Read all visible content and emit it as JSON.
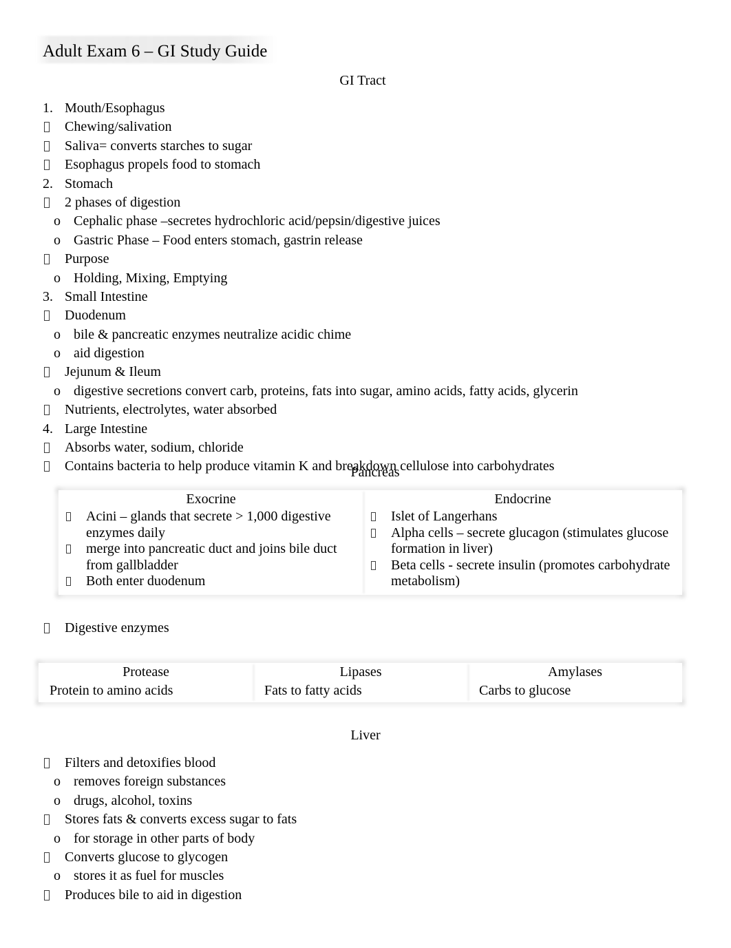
{
  "document": {
    "title": "Adult Exam 6 – GI Study Guide"
  },
  "sections": {
    "gi_tract": {
      "heading": "GI Tract",
      "items": [
        {
          "marker": "1.",
          "level": "num",
          "text": "Mouth/Esophagus"
        },
        {
          "marker": "tofu",
          "level": "sq",
          "text": "Chewing/salivation"
        },
        {
          "marker": "tofu",
          "level": "sq",
          "text": "Saliva= converts starches to sugar"
        },
        {
          "marker": "tofu",
          "level": "sq",
          "text": "Esophagus propels food to stomach"
        },
        {
          "marker": "2.",
          "level": "num",
          "text": "Stomach"
        },
        {
          "marker": "tofu",
          "level": "sq",
          "text": "2 phases of digestion"
        },
        {
          "marker": "o",
          "level": "o",
          "text": "Cephalic phase –secretes hydrochloric acid/pepsin/digestive juices"
        },
        {
          "marker": "o",
          "level": "o",
          "text": "Gastric Phase – Food enters stomach, gastrin release"
        },
        {
          "marker": "tofu",
          "level": "sq",
          "text": "Purpose"
        },
        {
          "marker": "o",
          "level": "o",
          "text": "Holding, Mixing, Emptying"
        },
        {
          "marker": "3.",
          "level": "num",
          "text": "Small Intestine"
        },
        {
          "marker": "tofu",
          "level": "sq",
          "text": "Duodenum"
        },
        {
          "marker": "o",
          "level": "o",
          "text": "bile & pancreatic enzymes neutralize acidic chime"
        },
        {
          "marker": "o",
          "level": "o",
          "text": "aid digestion"
        },
        {
          "marker": "tofu",
          "level": "sq",
          "text": "Jejunum & Ileum"
        },
        {
          "marker": "o",
          "level": "o",
          "text": "digestive secretions convert carb, proteins, fats into sugar, amino acids, fatty acids, glycerin"
        },
        {
          "marker": "tofu",
          "level": "sq",
          "text": " Nutrients, electrolytes, water absorbed"
        },
        {
          "marker": "4.",
          "level": "num",
          "text": "Large Intestine"
        },
        {
          "marker": "tofu",
          "level": "sq",
          "text": "Absorbs water, sodium, chloride"
        },
        {
          "marker": "tofu",
          "level": "sq",
          "text": "Contains bacteria to help produce vitamin K and breakdown cellulose into carbohydrates"
        }
      ]
    },
    "pancreas": {
      "heading": "Pancreas",
      "table": {
        "columns": [
          {
            "header": "Exocrine",
            "bullets": [
              "Acini – glands that secrete > 1,000 digestive enzymes daily",
              "merge into pancreatic duct and joins bile duct from gallbladder",
              "Both enter duodenum"
            ]
          },
          {
            "header": "Endocrine",
            "bullets": [
              "Islet of Langerhans",
              "Alpha cells – secrete glucagon (stimulates glucose formation in liver)",
              "Beta cells - secrete insulin (promotes carbohydrate metabolism)"
            ]
          }
        ]
      },
      "digestive_enzymes_item": {
        "marker": "tofu",
        "level": "sq",
        "text": "Digestive enzymes"
      },
      "enzyme_table": {
        "headers": [
          "Protease",
          "Lipases",
          "Amylases"
        ],
        "values": [
          "Protein to amino acids",
          "Fats to fatty acids",
          "Carbs to glucose"
        ]
      }
    },
    "liver": {
      "heading": "Liver",
      "items": [
        {
          "marker": "tofu",
          "level": "sq",
          "text": "Filters and detoxifies blood"
        },
        {
          "marker": "o",
          "level": "o",
          "text": "removes foreign substances"
        },
        {
          "marker": "o",
          "level": "o",
          "text": "drugs, alcohol, toxins"
        },
        {
          "marker": "tofu",
          "level": "sq",
          "text": "Stores fats & converts excess sugar to fats"
        },
        {
          "marker": "o",
          "level": "o",
          "text": "for storage in other parts of body"
        },
        {
          "marker": "tofu",
          "level": "sq",
          "text": "Converts glucose to glycogen"
        },
        {
          "marker": "o",
          "level": "o",
          "text": "stores it as fuel for muscles"
        },
        {
          "marker": "tofu",
          "level": "sq",
          "text": "Produces bile to aid in digestion"
        }
      ]
    }
  }
}
